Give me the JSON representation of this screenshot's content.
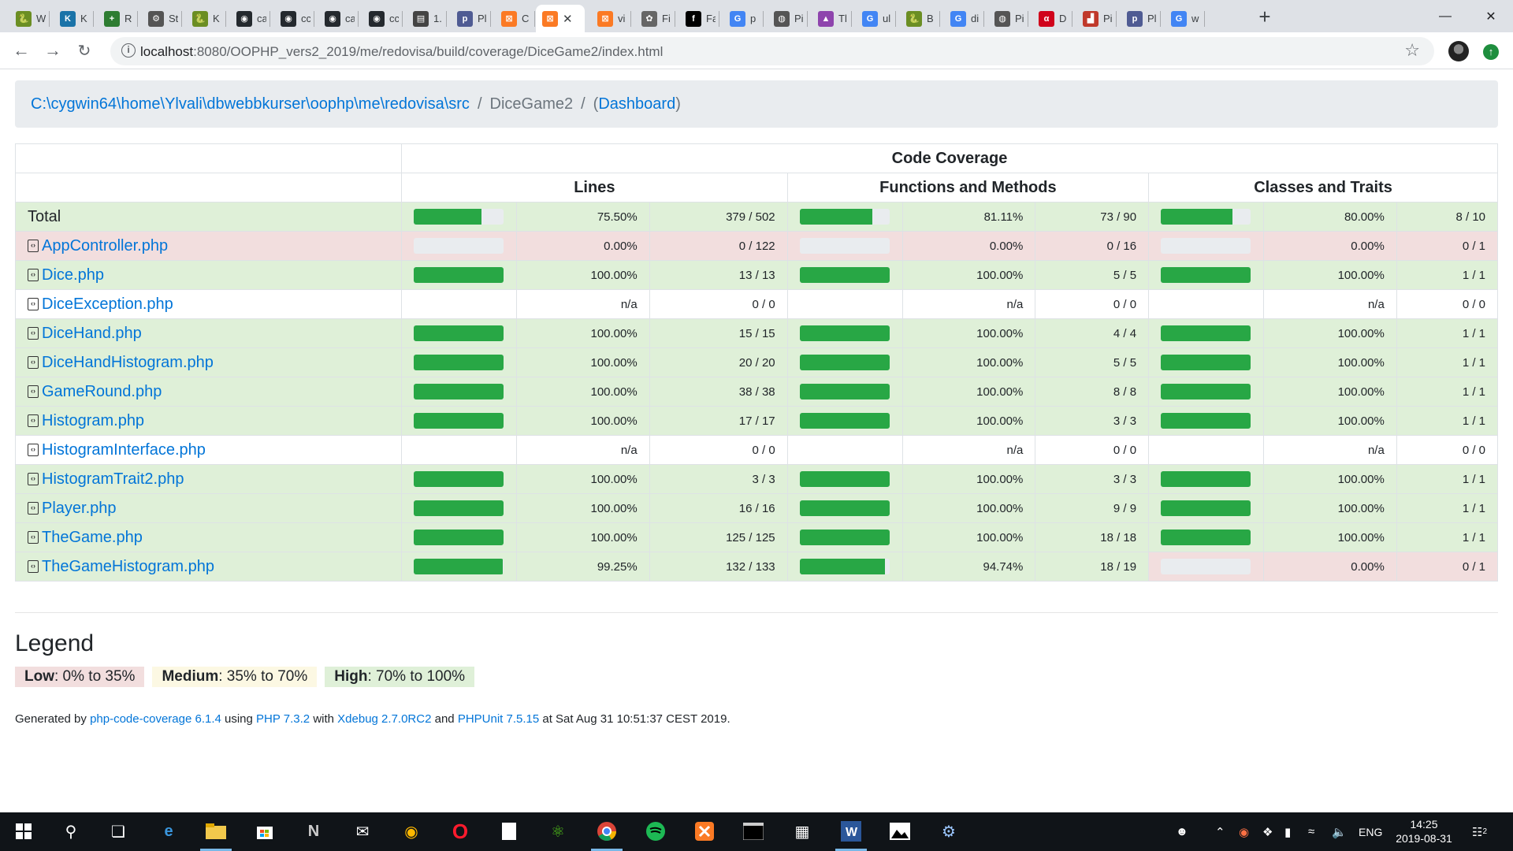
{
  "browser": {
    "tabs": [
      {
        "label": "W",
        "icon": "snake-icon",
        "color": "#6b8e23",
        "glyph": "🐍"
      },
      {
        "label": "K",
        "icon": "kalle-icon",
        "color": "#1a73a8",
        "glyph": "K"
      },
      {
        "label": "R",
        "icon": "plus-cross-icon",
        "color": "#2e7d32",
        "glyph": "+"
      },
      {
        "label": "St",
        "icon": "wheel-icon",
        "color": "#555555",
        "glyph": "⚙"
      },
      {
        "label": "K",
        "icon": "snake-icon",
        "color": "#6b8e23",
        "glyph": "🐍"
      },
      {
        "label": "ca",
        "icon": "github-icon",
        "color": "#24292e",
        "glyph": "◉"
      },
      {
        "label": "cc",
        "icon": "github-icon",
        "color": "#24292e",
        "glyph": "◉"
      },
      {
        "label": "ca",
        "icon": "github-icon",
        "color": "#24292e",
        "glyph": "◉"
      },
      {
        "label": "cc",
        "icon": "github-icon",
        "color": "#24292e",
        "glyph": "◉"
      },
      {
        "label": "1.",
        "icon": "book-icon",
        "color": "#444444",
        "glyph": "▤"
      },
      {
        "label": "Pl",
        "icon": "php-icon",
        "color": "#4f5b93",
        "glyph": "p"
      },
      {
        "label": "C",
        "icon": "xampp-icon",
        "color": "#fb7a24",
        "glyph": "⊠"
      },
      {
        "label": "",
        "icon": "xampp-icon",
        "color": "#fb7a24",
        "glyph": "⊠",
        "active": true
      },
      {
        "label": "vi",
        "icon": "xampp-icon",
        "color": "#fb7a24",
        "glyph": "⊠"
      },
      {
        "label": "Fi",
        "icon": "puzzle-icon",
        "color": "#666666",
        "glyph": "✿"
      },
      {
        "label": "Fa",
        "icon": "fa-icon",
        "color": "#000000",
        "glyph": "f"
      },
      {
        "label": "p",
        "icon": "google-icon",
        "color": "#4285f4",
        "glyph": "G"
      },
      {
        "label": "Pi",
        "icon": "globe-icon",
        "color": "#555555",
        "glyph": "◍"
      },
      {
        "label": "Tl",
        "icon": "purple-icon",
        "color": "#8e44ad",
        "glyph": "▲"
      },
      {
        "label": "ul",
        "icon": "google-icon",
        "color": "#4285f4",
        "glyph": "G"
      },
      {
        "label": "B",
        "icon": "snake-icon",
        "color": "#6b8e23",
        "glyph": "🐍"
      },
      {
        "label": "di",
        "icon": "google-icon",
        "color": "#4285f4",
        "glyph": "G"
      },
      {
        "label": "Pi",
        "icon": "globe-icon",
        "color": "#555555",
        "glyph": "◍"
      },
      {
        "label": "D",
        "icon": "red-icon",
        "color": "#d0021b",
        "glyph": "α"
      },
      {
        "label": "Pi",
        "icon": "bars-icon",
        "color": "#c0392b",
        "glyph": "▟"
      },
      {
        "label": "Pl",
        "icon": "php-icon",
        "color": "#4f5b93",
        "glyph": "p"
      },
      {
        "label": "w",
        "icon": "google-icon",
        "color": "#4285f4",
        "glyph": "G"
      }
    ],
    "active_close": "✕",
    "new_tab": "+",
    "url_host": "localhost",
    "url_path": ":8080/OOPHP_vers2_2019/me/redovisa/build/coverage/DiceGame2/index.html"
  },
  "breadcrumb": {
    "root": "C:\\cygwin64\\home\\Ylvali\\dbwebbkurser\\oophp\\me\\redovisa\\src",
    "sep": "/",
    "current": "DiceGame2",
    "open_paren": "(",
    "dashboard": "Dashboard",
    "close_paren": ")"
  },
  "table": {
    "header_top": "Code Coverage",
    "col_lines": "Lines",
    "col_functions": "Functions and Methods",
    "col_classes": "Classes and Traits",
    "rows": [
      {
        "name": "Total",
        "is_total": true,
        "lines_pct": 75.5,
        "lines_pct_text": "75.50%",
        "lines_ratio": "379 / 502",
        "fn_pct": 81.11,
        "fn_pct_text": "81.11%",
        "fn_ratio": "73 / 90",
        "cls_pct": 80.0,
        "cls_pct_text": "80.00%",
        "cls_ratio": "8 / 10",
        "lines_level": "high",
        "fn_level": "high",
        "cls_level": "high"
      },
      {
        "name": "AppController.php",
        "lines_pct": 0,
        "lines_pct_text": "0.00%",
        "lines_ratio": "0 / 122",
        "fn_pct": 0,
        "fn_pct_text": "0.00%",
        "fn_ratio": "0 / 16",
        "cls_pct": 0,
        "cls_pct_text": "0.00%",
        "cls_ratio": "0 / 1",
        "lines_level": "low",
        "fn_level": "low",
        "cls_level": "low"
      },
      {
        "name": "Dice.php",
        "lines_pct": 100,
        "lines_pct_text": "100.00%",
        "lines_ratio": "13 / 13",
        "fn_pct": 100,
        "fn_pct_text": "100.00%",
        "fn_ratio": "5 / 5",
        "cls_pct": 100,
        "cls_pct_text": "100.00%",
        "cls_ratio": "1 / 1",
        "lines_level": "high",
        "fn_level": "high",
        "cls_level": "high"
      },
      {
        "name": "DiceException.php",
        "lines_pct": null,
        "lines_pct_text": "n/a",
        "lines_ratio": "0 / 0",
        "fn_pct": null,
        "fn_pct_text": "n/a",
        "fn_ratio": "0 / 0",
        "cls_pct": null,
        "cls_pct_text": "n/a",
        "cls_ratio": "0 / 0",
        "lines_level": "none",
        "fn_level": "none",
        "cls_level": "none"
      },
      {
        "name": "DiceHand.php",
        "lines_pct": 100,
        "lines_pct_text": "100.00%",
        "lines_ratio": "15 / 15",
        "fn_pct": 100,
        "fn_pct_text": "100.00%",
        "fn_ratio": "4 / 4",
        "cls_pct": 100,
        "cls_pct_text": "100.00%",
        "cls_ratio": "1 / 1",
        "lines_level": "high",
        "fn_level": "high",
        "cls_level": "high"
      },
      {
        "name": "DiceHandHistogram.php",
        "lines_pct": 100,
        "lines_pct_text": "100.00%",
        "lines_ratio": "20 / 20",
        "fn_pct": 100,
        "fn_pct_text": "100.00%",
        "fn_ratio": "5 / 5",
        "cls_pct": 100,
        "cls_pct_text": "100.00%",
        "cls_ratio": "1 / 1",
        "lines_level": "high",
        "fn_level": "high",
        "cls_level": "high"
      },
      {
        "name": "GameRound.php",
        "lines_pct": 100,
        "lines_pct_text": "100.00%",
        "lines_ratio": "38 / 38",
        "fn_pct": 100,
        "fn_pct_text": "100.00%",
        "fn_ratio": "8 / 8",
        "cls_pct": 100,
        "cls_pct_text": "100.00%",
        "cls_ratio": "1 / 1",
        "lines_level": "high",
        "fn_level": "high",
        "cls_level": "high"
      },
      {
        "name": "Histogram.php",
        "lines_pct": 100,
        "lines_pct_text": "100.00%",
        "lines_ratio": "17 / 17",
        "fn_pct": 100,
        "fn_pct_text": "100.00%",
        "fn_ratio": "3 / 3",
        "cls_pct": 100,
        "cls_pct_text": "100.00%",
        "cls_ratio": "1 / 1",
        "lines_level": "high",
        "fn_level": "high",
        "cls_level": "high"
      },
      {
        "name": "HistogramInterface.php",
        "lines_pct": null,
        "lines_pct_text": "n/a",
        "lines_ratio": "0 / 0",
        "fn_pct": null,
        "fn_pct_text": "n/a",
        "fn_ratio": "0 / 0",
        "cls_pct": null,
        "cls_pct_text": "n/a",
        "cls_ratio": "0 / 0",
        "lines_level": "none",
        "fn_level": "none",
        "cls_level": "none"
      },
      {
        "name": "HistogramTrait2.php",
        "lines_pct": 100,
        "lines_pct_text": "100.00%",
        "lines_ratio": "3 / 3",
        "fn_pct": 100,
        "fn_pct_text": "100.00%",
        "fn_ratio": "3 / 3",
        "cls_pct": 100,
        "cls_pct_text": "100.00%",
        "cls_ratio": "1 / 1",
        "lines_level": "high",
        "fn_level": "high",
        "cls_level": "high"
      },
      {
        "name": "Player.php",
        "lines_pct": 100,
        "lines_pct_text": "100.00%",
        "lines_ratio": "16 / 16",
        "fn_pct": 100,
        "fn_pct_text": "100.00%",
        "fn_ratio": "9 / 9",
        "cls_pct": 100,
        "cls_pct_text": "100.00%",
        "cls_ratio": "1 / 1",
        "lines_level": "high",
        "fn_level": "high",
        "cls_level": "high"
      },
      {
        "name": "TheGame.php",
        "lines_pct": 100,
        "lines_pct_text": "100.00%",
        "lines_ratio": "125 / 125",
        "fn_pct": 100,
        "fn_pct_text": "100.00%",
        "fn_ratio": "18 / 18",
        "cls_pct": 100,
        "cls_pct_text": "100.00%",
        "cls_ratio": "1 / 1",
        "lines_level": "high",
        "fn_level": "high",
        "cls_level": "high"
      },
      {
        "name": "TheGameHistogram.php",
        "lines_pct": 99.25,
        "lines_pct_text": "99.25%",
        "lines_ratio": "132 / 133",
        "fn_pct": 94.74,
        "fn_pct_text": "94.74%",
        "fn_ratio": "18 / 19",
        "cls_pct": 0,
        "cls_pct_text": "0.00%",
        "cls_ratio": "0 / 1",
        "lines_level": "high",
        "fn_level": "high",
        "cls_level": "low"
      }
    ]
  },
  "legend": {
    "title": "Legend",
    "low_label": "Low",
    "low_range": ": 0% to 35%",
    "medium_label": "Medium",
    "medium_range": ": 35% to 70%",
    "high_label": "High",
    "high_range": ": 70% to 100%"
  },
  "footer": {
    "t1": "Generated by ",
    "l1": "php-code-coverage 6.1.4",
    "t2": " using ",
    "l2": "PHP 7.3.2",
    "t3": " with ",
    "l3": "Xdebug 2.7.0RC2",
    "t4": " and ",
    "l4": "PHPUnit 7.5.15",
    "t5": " at Sat Aug 31 10:51:37 CEST 2019."
  },
  "taskbar": {
    "lang": "ENG",
    "time": "14:25",
    "date": "2019-08-31",
    "notifications": "2"
  },
  "colors": {
    "success_bg": "#dff0d8",
    "danger_bg": "#f2dede",
    "warning_bg": "#fcf8e3",
    "bar_fill": "#28a745",
    "link": "#0275d8"
  }
}
